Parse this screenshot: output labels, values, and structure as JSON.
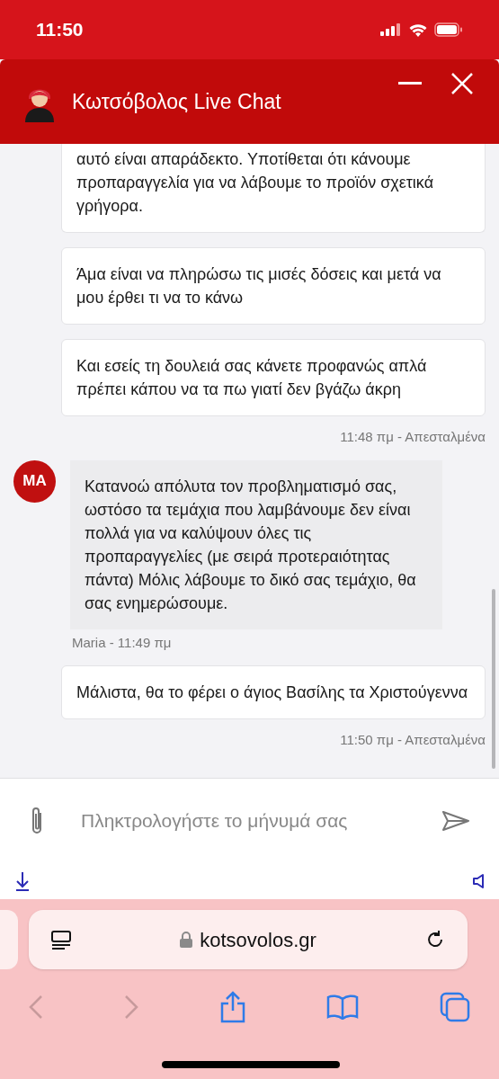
{
  "status_bar": {
    "time": "11:50"
  },
  "header": {
    "title": "Κωτσόβολος Live Chat"
  },
  "groups": [
    {
      "kind": "sent",
      "bubbles": [
        {
          "text": "αυτό είναι απαράδεκτο. Υποτίθεται ότι κάνουμε προπαραγγελία για να λάβουμε το προϊόν σχετικά γρήγορα.",
          "cut_off": true
        },
        {
          "text": "Άμα είναι να πληρώσω τις μισές δόσεις και μετά να μου έρθει τι να το κάνω",
          "cut_off": false
        },
        {
          "text": "Και εσείς τη δουλειά σας κάνετε προφανώς απλά πρέπει κάπου να τα πω γιατί δεν βγάζω άκρη",
          "cut_off": false
        }
      ],
      "meta": "11:48 πμ - Απεσταλμένα"
    },
    {
      "kind": "received",
      "avatar": "MA",
      "bubbles": [
        {
          "text": "Κατανοώ απόλυτα τον προβληματισμό σας, ωστόσο τα τεμάχια που λαμβάνουμε δεν είναι πολλά για να καλύψουν όλες τις προπαραγγελίες (με σειρά προτεραιότητας πάντα) Μόλις λάβουμε το δικό σας τεμάχιο, θα σας ενημερώσουμε.",
          "cut_off": false
        }
      ],
      "meta": "Maria - 11:49 πμ"
    },
    {
      "kind": "sent",
      "bubbles": [
        {
          "text": "Μάλιστα, θα το φέρει ο άγιος Βασίλης τα Χριστούγεννα",
          "cut_off": false
        }
      ],
      "meta": "11:50 πμ - Απεσταλμένα"
    }
  ],
  "composer": {
    "placeholder": "Πληκτρολογήστε το μήνυμά σας"
  },
  "browser": {
    "address": "kotsovolos.gr"
  }
}
